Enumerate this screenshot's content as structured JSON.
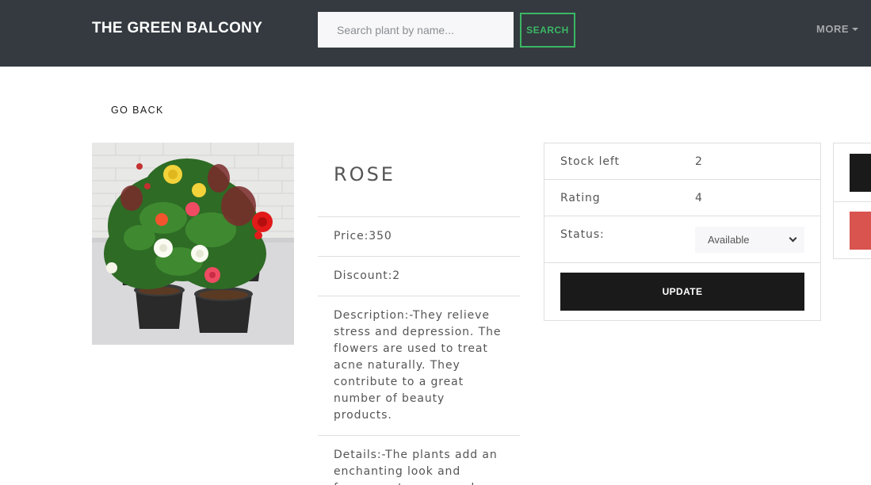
{
  "navbar": {
    "brand": "THE GREEN BALCONY",
    "search_placeholder": "Search plant by name...",
    "search_button": "SEARCH",
    "more_label": "MORE"
  },
  "go_back": "GO BACK",
  "product": {
    "name": "ROSE",
    "image_icon": "rose-plant-photo",
    "price": "Price:350",
    "discount": "Discount:2",
    "description": "Description:-They relieve stress and depression. The flowers are used to treat acne naturally. They contribute to a great number of beauty products.",
    "details": "Details:-The plants add an enchanting look and fragrance to your garden."
  },
  "stock_card": {
    "stock_label": "Stock left",
    "stock_value": "2",
    "rating_label": "Rating",
    "rating_value": "4",
    "status_label": "Status:",
    "status_selected": "Available",
    "update_button": "UPDATE"
  },
  "colors": {
    "navbar_bg": "#343a40",
    "accent_green": "#3cb764",
    "button_dark": "#1a1a1a",
    "button_red": "#d9534f"
  }
}
